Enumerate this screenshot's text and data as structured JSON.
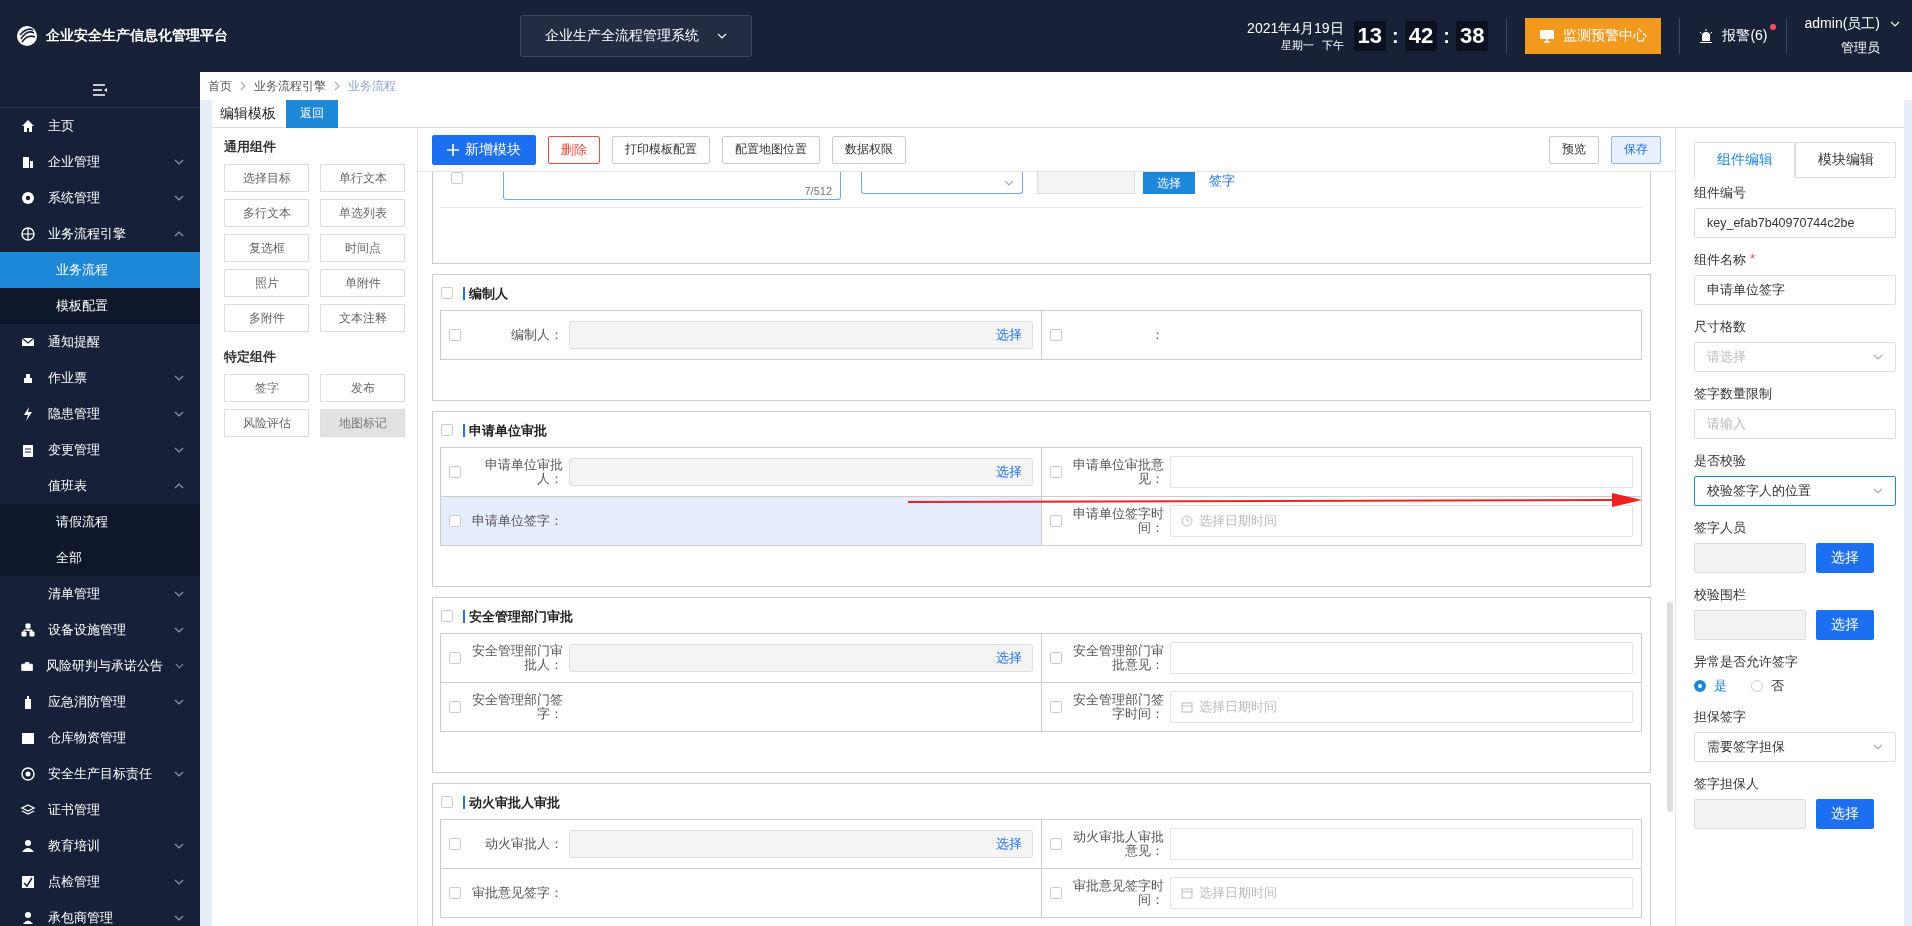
{
  "header": {
    "title": "企业安全生产信息化管理平台",
    "system_select": "企业生产全流程管理系统",
    "date": "2021年4月19日",
    "weekday": "星期一",
    "period": "下午",
    "clock": [
      {
        "kind": "digits",
        "text": "13"
      },
      {
        "kind": "sep",
        "text": ":"
      },
      {
        "kind": "digits",
        "text": "42"
      },
      {
        "kind": "sep",
        "text": ":"
      },
      {
        "kind": "digits",
        "text": "38"
      }
    ],
    "monitor_button": "监测预警中心",
    "alarm": "报警(6)",
    "user": "admin(员工)",
    "role": "管理员"
  },
  "sidebar": {
    "items": [
      {
        "label": "主页"
      },
      {
        "label": "企业管理",
        "expanded": false
      },
      {
        "label": "系统管理",
        "expanded": false
      },
      {
        "label": "业务流程引擎",
        "expanded": true,
        "children": [
          {
            "label": "业务流程",
            "selected": true
          },
          {
            "label": "模板配置",
            "selected": false
          }
        ]
      },
      {
        "label": "通知提醒"
      },
      {
        "label": "作业票",
        "expanded": false
      },
      {
        "label": "隐患管理",
        "expanded": false
      },
      {
        "label": "变更管理",
        "expanded": false
      },
      {
        "label": "值班表",
        "expanded": true,
        "children": [
          {
            "label": "请假流程",
            "selected": false
          },
          {
            "label": "全部",
            "selected": false
          }
        ]
      },
      {
        "label": "清单管理",
        "expanded": false
      },
      {
        "label": "设备设施管理",
        "expanded": false
      },
      {
        "label": "风险研判与承诺公告",
        "expanded": false
      },
      {
        "label": "应急消防管理",
        "expanded": false
      },
      {
        "label": "仓库物资管理"
      },
      {
        "label": "安全生产目标责任",
        "expanded": false
      },
      {
        "label": "证书管理"
      },
      {
        "label": "教育培训",
        "expanded": false
      },
      {
        "label": "点检管理",
        "expanded": false
      },
      {
        "label": "承包商管理",
        "expanded": false
      }
    ]
  },
  "breadcrumb": [
    {
      "label": "首页",
      "current": false
    },
    {
      "label": "业务流程引擎",
      "current": false
    },
    {
      "label": "业务流程",
      "current": true
    }
  ],
  "page_title": "编辑模板",
  "back_button": "返回",
  "component_groups": [
    {
      "title": "通用组件",
      "items": [
        {
          "label": "选择目标",
          "disabled": false
        },
        {
          "label": "单行文本",
          "disabled": false
        },
        {
          "label": "多行文本",
          "disabled": false
        },
        {
          "label": "单选列表",
          "disabled": false
        },
        {
          "label": "复选框",
          "disabled": false
        },
        {
          "label": "时间点",
          "disabled": false
        },
        {
          "label": "照片",
          "disabled": false
        },
        {
          "label": "单附件",
          "disabled": false
        },
        {
          "label": "多附件",
          "disabled": false
        },
        {
          "label": "文本注释",
          "disabled": false
        }
      ]
    },
    {
      "title": "特定组件",
      "items": [
        {
          "label": "签字",
          "disabled": false
        },
        {
          "label": "发布",
          "disabled": false
        },
        {
          "label": "风险评估",
          "disabled": false
        },
        {
          "label": "地图标记",
          "disabled": true
        }
      ]
    }
  ],
  "toolbar": {
    "left": [
      {
        "kind": "primary",
        "label": "新增模块"
      },
      {
        "kind": "danger",
        "label": "删除"
      },
      {
        "kind": "default",
        "label": "打印模板配置"
      },
      {
        "kind": "default",
        "label": "配置地图位置"
      },
      {
        "kind": "default",
        "label": "数据权限"
      }
    ],
    "right": [
      {
        "kind": "default",
        "label": "预览"
      },
      {
        "kind": "plain-primary",
        "label": "保存"
      }
    ]
  },
  "partial_module": {
    "checked": false,
    "counter": "7/512",
    "button": "选择",
    "link": "签字"
  },
  "modules": [
    {
      "title": "编制人",
      "checked": false,
      "rows": [
        [
          {
            "kind": "picker",
            "label": "编制人：",
            "action": "选择",
            "checked": false,
            "selected": false
          },
          {
            "kind": "blank",
            "label": "：",
            "checked": false,
            "selected": false
          }
        ]
      ]
    },
    {
      "title": "申请单位审批",
      "checked": false,
      "rows": [
        [
          {
            "kind": "picker",
            "label": "申请单位审批人：",
            "action": "选择",
            "checked": false,
            "selected": false
          },
          {
            "kind": "text",
            "label": "申请单位审批意见：",
            "checked": false,
            "selected": false
          }
        ],
        [
          {
            "kind": "sign",
            "label": "申请单位签字：",
            "checked": false,
            "selected": true
          },
          {
            "kind": "time",
            "label": "申请单位签字时间：",
            "placeholder": "选择日期时间",
            "checked": false,
            "selected": false
          }
        ]
      ]
    },
    {
      "title": "安全管理部门审批",
      "checked": false,
      "rows": [
        [
          {
            "kind": "picker",
            "label": "安全管理部门审批人：",
            "action": "选择",
            "checked": false,
            "selected": false
          },
          {
            "kind": "text",
            "label": "安全管理部门审批意见：",
            "checked": false,
            "selected": false
          }
        ],
        [
          {
            "kind": "sign",
            "label": "安全管理部门签字：",
            "checked": false,
            "selected": false
          },
          {
            "kind": "date",
            "label": "安全管理部门签字时间：",
            "placeholder": "选择日期时间",
            "checked": false,
            "selected": false
          }
        ]
      ]
    },
    {
      "title": "动火审批人审批",
      "checked": false,
      "rows": [
        [
          {
            "kind": "picker",
            "label": "动火审批人：",
            "action": "选择",
            "checked": false,
            "selected": false
          },
          {
            "kind": "text",
            "label": "动火审批人审批意见：",
            "checked": false,
            "selected": false
          }
        ],
        [
          {
            "kind": "sign",
            "label": "审批意见签字：",
            "checked": false,
            "selected": false
          },
          {
            "kind": "date",
            "label": "审批意见签字时间：",
            "placeholder": "选择日期时间",
            "checked": false,
            "selected": false
          }
        ]
      ]
    }
  ],
  "properties": {
    "tabs": [
      {
        "label": "组件编辑",
        "selected": true
      },
      {
        "label": "模块编辑",
        "selected": false
      }
    ],
    "fields": [
      {
        "kind": "text",
        "label": "组件编号",
        "value": "key_efab7b40970744c2be"
      },
      {
        "kind": "text",
        "label": "组件名称",
        "required": true,
        "required_mark": "*",
        "value": "申请单位签字"
      },
      {
        "kind": "select",
        "label": "尺寸格数",
        "placeholder": "请选择"
      },
      {
        "kind": "text",
        "label": "签字数量限制",
        "placeholder": "请输入"
      },
      {
        "kind": "select",
        "label": "是否校验",
        "value": "校验签字人的位置",
        "focused": true
      },
      {
        "kind": "picker",
        "label": "签字人员",
        "action": "选择"
      },
      {
        "kind": "picker",
        "label": "校验围栏",
        "action": "选择"
      },
      {
        "kind": "radio",
        "label": "异常是否允许签字",
        "options": [
          {
            "label": "是",
            "selected": true
          },
          {
            "label": "否",
            "selected": false
          }
        ]
      },
      {
        "kind": "select",
        "label": "担保签字",
        "value": "需要签字担保"
      },
      {
        "kind": "picker",
        "label": "签字担保人",
        "action": "选择"
      }
    ]
  }
}
